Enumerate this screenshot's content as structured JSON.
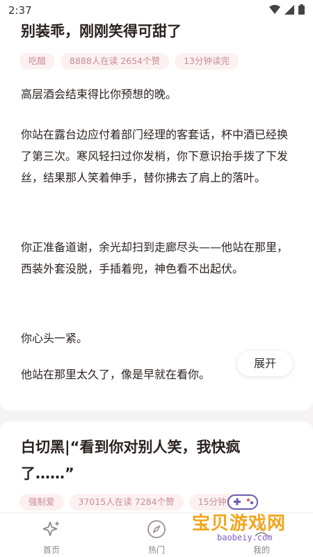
{
  "status_bar": {
    "time": "2:37"
  },
  "post1": {
    "title": "别装乖，刚刚笑得可甜了",
    "tags": [
      "吃醋",
      "8888人在读 2654个赞",
      "13分钟读完"
    ],
    "paragraphs": [
      "高层酒会结束得比你预想的晚。",
      "你站在露台边应付着部门经理的客套话，杯中酒已经换了第三次。寒风轻扫过你发梢，你下意识抬手拨了下发丝，结果那人笑着伸手，替你拂去了肩上的落叶。",
      "你正准备道谢，余光却扫到走廊尽头——他站在那里，西装外套没脱，手插着兜，神色看不出起伏。",
      "你心头一紧。",
      "他站在那里太久了，像是早就在看你。"
    ],
    "expand_label": "展开"
  },
  "post2": {
    "title": "白切黑|“看到你对别人笑，我快疯了……”",
    "tags": [
      "强制爱",
      "37015人在读 7284个赞",
      "15分钟读完"
    ]
  },
  "bottom_nav": [
    {
      "label": "首页",
      "icon": "sparkle-icon"
    },
    {
      "label": "热门",
      "icon": "compass-icon"
    },
    {
      "label": "我的",
      "icon": "profile-icon"
    }
  ],
  "watermark": {
    "text": "宝贝游戏网",
    "url": "baobeiy.com"
  },
  "colors": {
    "tag_bg": "#fcf0f1",
    "tag_text": "#c78d96",
    "watermark": "#f1a51d"
  }
}
